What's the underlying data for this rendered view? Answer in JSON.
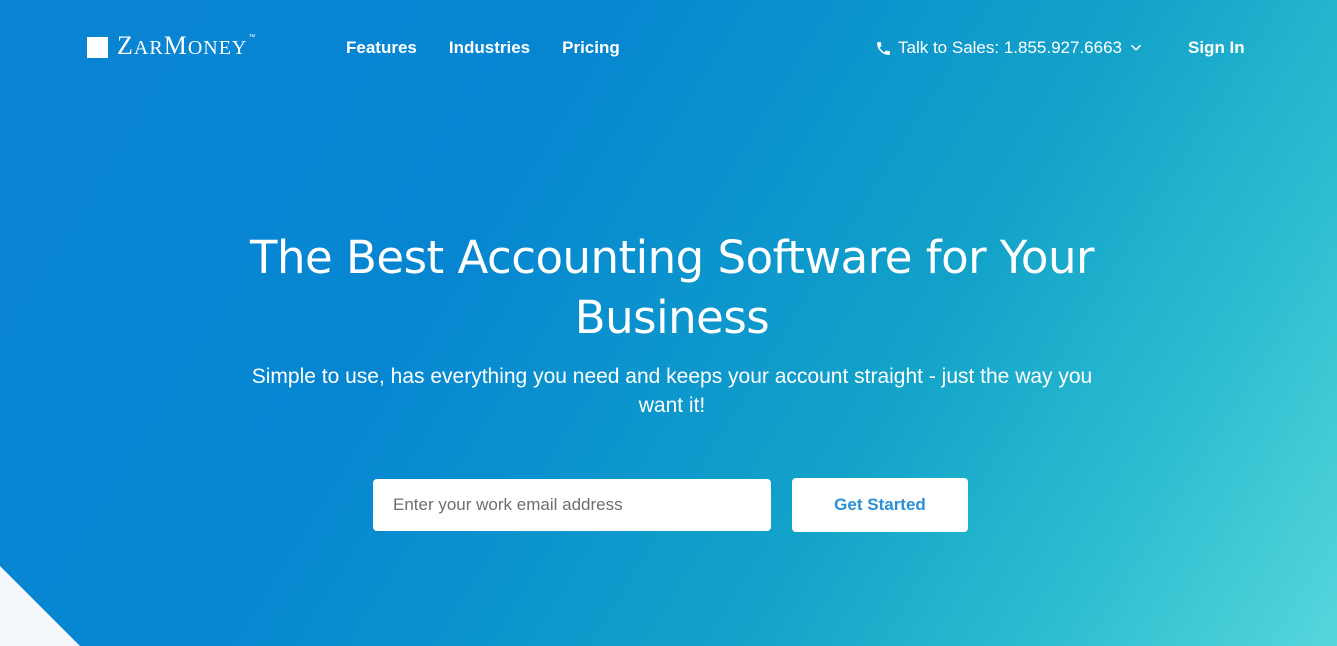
{
  "brand": {
    "name_first": "Z",
    "name_rest_a": "AR",
    "name_mid": "M",
    "name_rest_b": "ONEY",
    "trademark": "™"
  },
  "nav": {
    "links": [
      {
        "label": "Features"
      },
      {
        "label": "Industries"
      },
      {
        "label": "Pricing"
      }
    ],
    "sales": {
      "label": "Talk to Sales: 1.855.927.6663",
      "icon": "phone-icon",
      "dropdown_icon": "chevron-down-icon"
    },
    "sign_in_label": "Sign In"
  },
  "hero": {
    "title": "The Best Accounting Software for Your Business",
    "subtitle": "Simple to use, has everything you need and keeps your account straight - just the way you want it!",
    "email_placeholder": "Enter your work email address",
    "email_value": "",
    "cta_label": "Get Started"
  },
  "colors": {
    "gradient_start": "#0a84d4",
    "gradient_end": "#55d6db",
    "cta_text": "#2a8fd6",
    "white": "#ffffff"
  }
}
